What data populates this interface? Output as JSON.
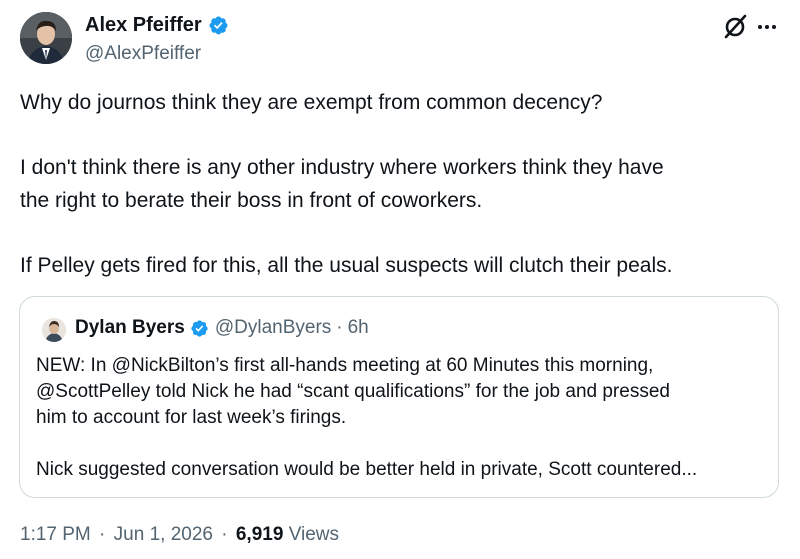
{
  "author": {
    "name": "Alex Pfeiffer",
    "handle": "@AlexPfeiffer",
    "verified": true
  },
  "tweet": {
    "paragraphs": [
      "Why do journos think they are exempt from common decency?",
      "I don't think there is any other industry where workers think they have\nthe right to berate their boss in front of coworkers.",
      "If Pelley gets fired for this, all the usual suspects will clutch their peals."
    ]
  },
  "quote": {
    "name": "Dylan Byers",
    "handle": "@DylanByers",
    "separator": "·",
    "time": "6h",
    "paragraphs": [
      "NEW: In @NickBilton’s first all-hands meeting at 60 Minutes this morning,\n@ScottPelley told Nick he had “scant qualifications” for the job and pressed\nhim to account for last week’s firings.",
      "Nick suggested conversation would be better held in private, Scott countered..."
    ]
  },
  "footer": {
    "time": "1:17 PM",
    "separator": "·",
    "date": "Jun 1, 2026",
    "views_count": "6,919",
    "views_label": "Views"
  },
  "icons": {
    "verified": "verified-badge-icon",
    "grok": "grok-icon",
    "more": "more-options-icon"
  },
  "colors": {
    "verified_blue": "#1d9bf0",
    "secondary_text": "#536471",
    "border": "#cfd9de"
  }
}
